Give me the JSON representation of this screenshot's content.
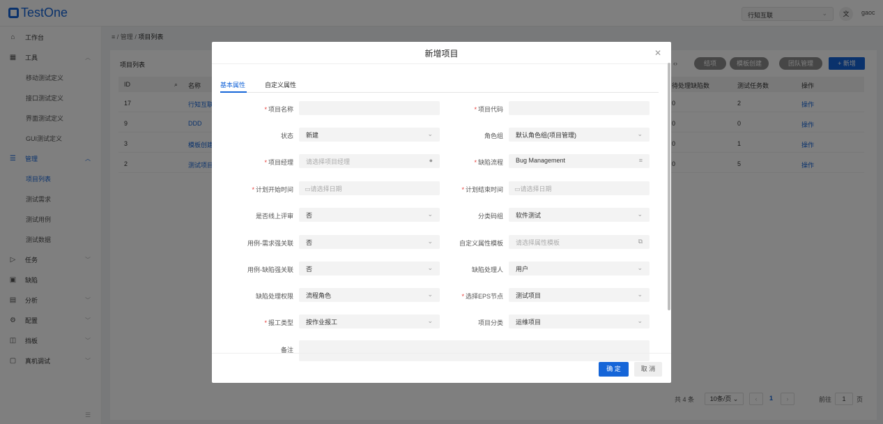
{
  "app": {
    "name": "TestOne"
  },
  "header": {
    "tenant": "行知互联",
    "user": "gaoc",
    "lang_icon": "translate-icon"
  },
  "sidebar": {
    "items": [
      {
        "label": "工作台",
        "icon": "home-icon"
      },
      {
        "label": "工具",
        "icon": "grid-icon"
      },
      {
        "label": "移动测试定义"
      },
      {
        "label": "接口测试定义"
      },
      {
        "label": "界面测试定义"
      },
      {
        "label": "GUI测试定义"
      },
      {
        "label": "管理",
        "icon": "list-icon"
      },
      {
        "label": "项目列表"
      },
      {
        "label": "测试需求"
      },
      {
        "label": "测试用例"
      },
      {
        "label": "测试数据"
      },
      {
        "label": "任务",
        "icon": "send-icon"
      },
      {
        "label": "缺陷",
        "icon": "bug-icon"
      },
      {
        "label": "分析",
        "icon": "calendar-icon"
      },
      {
        "label": "配置",
        "icon": "gear-icon"
      },
      {
        "label": "挡板",
        "icon": "panel-icon"
      },
      {
        "label": "真机调试",
        "icon": "device-icon"
      }
    ]
  },
  "breadcrumb": {
    "root": "管理",
    "sep": "/",
    "current": "项目列表"
  },
  "list": {
    "title": "项目列表",
    "buttons": {
      "close": "结项",
      "template_create": "模板创建",
      "team": "团队管理",
      "add": "+ 新增"
    },
    "columns": [
      "ID",
      "名称",
      "待处理缺陷数",
      "测试任务数",
      "操作"
    ],
    "rows": [
      {
        "id": "17",
        "name": "行知互联",
        "defects": "0",
        "tasks": "2",
        "op": "操作"
      },
      {
        "id": "9",
        "name": "DDD",
        "defects": "0",
        "tasks": "0",
        "op": "操作"
      },
      {
        "id": "3",
        "name": "模板创建",
        "defects": "0",
        "tasks": "1",
        "op": "操作"
      },
      {
        "id": "2",
        "name": "测试项目",
        "defects": "0",
        "tasks": "5",
        "op": "操作"
      }
    ],
    "pager": {
      "total": "共 4 条",
      "size": "10条/页",
      "page": "1",
      "goto": "前往",
      "goto_value": "1",
      "page_unit": "页"
    }
  },
  "modal": {
    "title": "新增项目",
    "tabs": [
      "基本属性",
      "自定义属性"
    ],
    "fields": {
      "name_label": "项目名称",
      "name_value": "",
      "code_label": "项目代码",
      "code_value": "",
      "status_label": "状态",
      "status_value": "新建",
      "role_label": "角色组",
      "role_value": "默认角色组(项目管理)",
      "manager_label": "项目经理",
      "manager_placeholder": "请选择项目经理",
      "flow_label": "缺陷流程",
      "flow_value": "Bug Management",
      "start_label": "计划开始时间",
      "start_placeholder": "请选择日期",
      "end_label": "计划结束时间",
      "end_placeholder": "请选择日期",
      "online_label": "是否线上评审",
      "online_value": "否",
      "category_code_label": "分类码组",
      "category_code_value": "软件测试",
      "case_req_label": "用例-需求强关联",
      "case_req_value": "否",
      "custom_tpl_label": "自定义属性模板",
      "custom_tpl_placeholder": "请选择属性模板",
      "case_bug_label": "用例-缺陷强关联",
      "case_bug_value": "否",
      "handler_label": "缺陷处理人",
      "handler_value": "用户",
      "perm_label": "缺陷处理权限",
      "perm_value": "流程角色",
      "eps_label": "选择EPS节点",
      "eps_value": "测试项目",
      "report_label": "报工类型",
      "report_value": "按作业报工",
      "proj_cat_label": "项目分类",
      "proj_cat_value": "运维项目",
      "remark_label": "备注"
    },
    "ok": "确 定",
    "cancel": "取 消"
  }
}
